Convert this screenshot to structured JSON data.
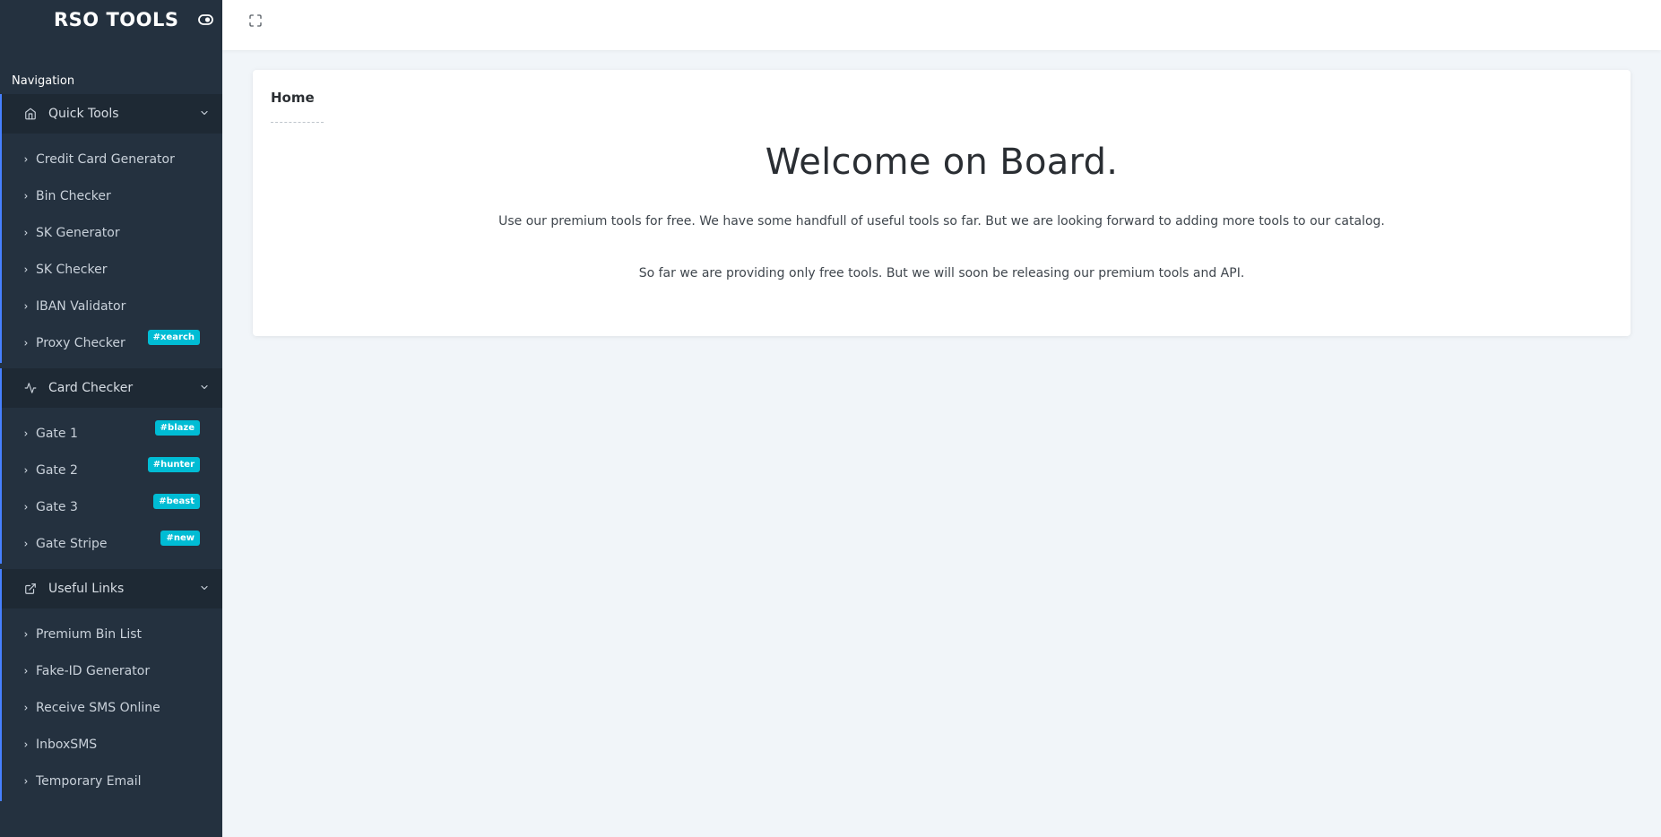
{
  "brand": {
    "title": "RSO TOOLS"
  },
  "nav": {
    "caption": "Navigation"
  },
  "groups": [
    {
      "label": "Quick Tools",
      "icon": "home-icon",
      "items": [
        {
          "label": "Credit Card Generator"
        },
        {
          "label": "Bin Checker"
        },
        {
          "label": "SK Generator"
        },
        {
          "label": "SK Checker"
        },
        {
          "label": "IBAN Validator"
        },
        {
          "label": "Proxy Checker",
          "badge": "#xearch"
        }
      ]
    },
    {
      "label": "Card Checker",
      "icon": "activity-icon",
      "items": [
        {
          "label": "Gate 1",
          "badge": "#blaze"
        },
        {
          "label": "Gate 2",
          "badge": "#hunter"
        },
        {
          "label": "Gate 3",
          "badge": "#beast"
        },
        {
          "label": "Gate Stripe",
          "badge": "#new"
        }
      ]
    },
    {
      "label": "Useful Links",
      "icon": "external-link-icon",
      "items": [
        {
          "label": "Premium Bin List"
        },
        {
          "label": "Fake-ID Generator"
        },
        {
          "label": "Receive SMS Online"
        },
        {
          "label": "InboxSMS"
        },
        {
          "label": "Temporary Email"
        }
      ]
    }
  ],
  "main": {
    "card_title": "Home",
    "heading": "Welcome on Board.",
    "paragraph_1": "Use our premium tools for free. We have some handfull of useful tools so far. But we are looking forward to adding more tools to our catalog.",
    "paragraph_2": "So far we are providing only free tools. But we will soon be releasing our premium tools and API."
  },
  "colors": {
    "sidebar_bg": "#24313f",
    "group_header_bg": "#1e2934",
    "accent": "#4680ff",
    "badge": "#00bcd4",
    "page_bg": "#f1f5f9"
  }
}
